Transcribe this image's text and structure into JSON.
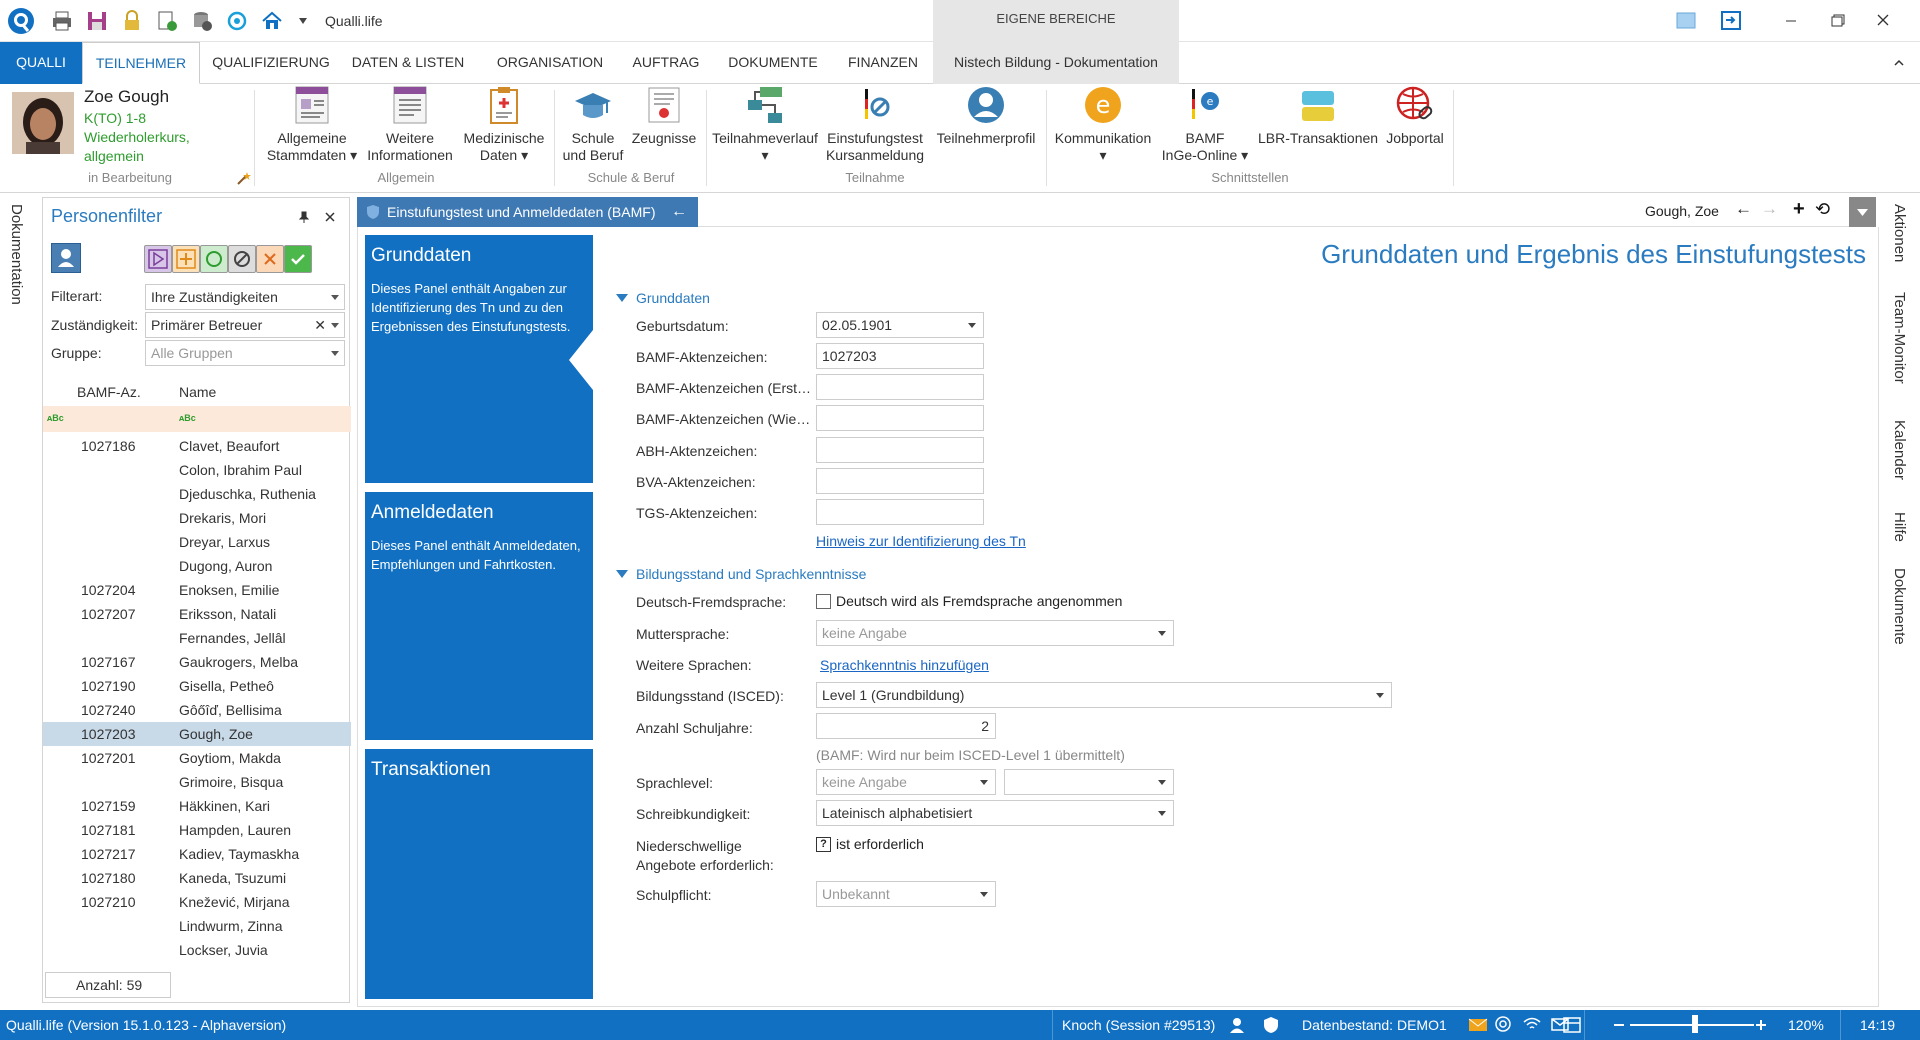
{
  "app": {
    "title": "Qualli.life",
    "context_header": "EIGENE BEREICHE"
  },
  "tabs": {
    "home": "QUALLI",
    "teilnehmer": "TEILNEHMER",
    "qualifizierung": "QUALIFIZIERUNG",
    "daten": "DATEN & LISTEN",
    "organisation": "ORGANISATION",
    "auftrag": "AUFTRAG",
    "dokumente": "DOKUMENTE",
    "finanzen": "FINANZEN",
    "context": "Nistech Bildung - Dokumentation"
  },
  "person": {
    "name": "Zoe Gough",
    "line1": "K(TO) 1-8",
    "line2": "Wiederholerkurs,",
    "line3": "allgemein",
    "status": "in Bearbeitung"
  },
  "ribbon": {
    "allgemeine_stammdaten": [
      "Allgemeine",
      "Stammdaten"
    ],
    "weitere_informationen": [
      "Weitere",
      "Informationen"
    ],
    "medizinische_daten": [
      "Medizinische",
      "Daten"
    ],
    "schule_beruf": [
      "Schule",
      "und Beruf"
    ],
    "zeugnisse": "Zeugnisse",
    "teilnahmeverlauf": "Teilnahmeverlauf",
    "einstufungstest": [
      "Einstufungstest",
      "Kursanmeldung"
    ],
    "teilnehmerprofil": "Teilnehmerprofil",
    "kommunikation": "Kommunikation",
    "bamf": [
      "BAMF",
      "InGe-Online"
    ],
    "lbr": "LBR-Transaktionen",
    "jobportal": "Jobportal",
    "groups": {
      "allgemein": "Allgemein",
      "schule": "Schule & Beruf",
      "teilnahme": "Teilnahme",
      "schnittstellen": "Schnittstellen"
    }
  },
  "side_left": "Dokumentation",
  "side_right": [
    "Aktionen",
    "Team-Monitor",
    "Kalender",
    "Hilfe",
    "Dokumente"
  ],
  "filter": {
    "title": "Personenfilter",
    "filterart_label": "Filterart:",
    "filterart_value": "Ihre Zuständigkeiten",
    "zustaendigkeit_label": "Zuständigkeit:",
    "zustaendigkeit_value": "Primärer Betreuer",
    "gruppe_label": "Gruppe:",
    "gruppe_placeholder": "Alle Gruppen",
    "col_az": "BAMF-Az.",
    "col_name": "Name",
    "rows": [
      {
        "az": "1027186",
        "name": "Clavet, Beaufort"
      },
      {
        "az": "",
        "name": "Colon, Ibrahim Paul"
      },
      {
        "az": "",
        "name": "Djeduschka, Ruthenia"
      },
      {
        "az": "",
        "name": "Drekaris, Mori"
      },
      {
        "az": "",
        "name": "Dreyar, Larxus"
      },
      {
        "az": "",
        "name": "Dugong, Auron"
      },
      {
        "az": "1027204",
        "name": "Enoksen, Emilie"
      },
      {
        "az": "1027207",
        "name": "Eriksson, Natali"
      },
      {
        "az": "",
        "name": "Fernandes, Jellâl"
      },
      {
        "az": "1027167",
        "name": "Gaukrogers, Melba"
      },
      {
        "az": "1027190",
        "name": "Gisella, Petheô"
      },
      {
        "az": "1027240",
        "name": "Gôőîď, Bellisima"
      },
      {
        "az": "1027203",
        "name": "Gough, Zoe"
      },
      {
        "az": "1027201",
        "name": "Goytiom, Makda"
      },
      {
        "az": "",
        "name": "Grimoire, Bisqua"
      },
      {
        "az": "1027159",
        "name": "Häkkinen, Kari"
      },
      {
        "az": "1027181",
        "name": "Hampden, Lauren"
      },
      {
        "az": "1027217",
        "name": "Kadiev, Taymaskha"
      },
      {
        "az": "1027180",
        "name": "Kaneda, Tsuzumi"
      },
      {
        "az": "1027210",
        "name": "Knežević, Mirjana"
      },
      {
        "az": "",
        "name": "Lindwurm, Zinna"
      },
      {
        "az": "",
        "name": "Lockser, Juvia"
      }
    ],
    "count": "Anzahl: 59"
  },
  "doc": {
    "tab": "Einstufungstest und Anmeldedaten (BAMF)",
    "current_person": "Gough, Zoe",
    "heading": "Grunddaten und Ergebnis des Einstufungstests"
  },
  "panels": [
    {
      "title": "Grunddaten",
      "desc": "Dieses Panel enthält Angaben zur Identifizierung des Tn und zu den Ergebnissen des Einstufungstests."
    },
    {
      "title": "Anmeldedaten",
      "desc": "Dieses Panel enthält Anmeldedaten, Empfehlungen und Fahrtkosten."
    },
    {
      "title": "Transaktionen",
      "desc": ""
    }
  ],
  "form": {
    "sec_grunddaten": "Grunddaten",
    "geburtsdatum_label": "Geburtsdatum:",
    "geburtsdatum": "02.05.1901",
    "bamf_az_label": "BAMF-Aktenzeichen:",
    "bamf_az": "1027203",
    "bamf_erst_label": "BAMF-Aktenzeichen (Erst…",
    "bamf_wie_label": "BAMF-Aktenzeichen (Wie…",
    "abh_label": "ABH-Aktenzeichen:",
    "bva_label": "BVA-Aktenzeichen:",
    "tgs_label": "TGS-Aktenzeichen:",
    "hinweis_link": "Hinweis zur Identifizierung des Tn",
    "sec_bildung": "Bildungsstand und Sprachkenntnisse",
    "deutsch_label": "Deutsch-Fremdsprache:",
    "deutsch_cb": "Deutsch wird als Fremdsprache angenommen",
    "mutter_label": "Muttersprache:",
    "mutter": "keine Angabe",
    "weitere_label": "Weitere Sprachen:",
    "weitere_link": "Sprachkenntnis hinzufügen",
    "bildungsstand_label": "Bildungsstand (ISCED):",
    "bildungsstand": "Level 1 (Grundbildung)",
    "schuljahre_label": "Anzahl Schuljahre:",
    "schuljahre": "2",
    "schuljahre_hint": "(BAMF: Wird nur beim ISCED-Level 1 übermittelt)",
    "sprachlevel_label": "Sprachlevel:",
    "sprachlevel": "keine Angabe",
    "schreib_label": "Schreibkundigkeit:",
    "schreib": "Lateinisch alphabetisiert",
    "nieder_label1": "Niederschwellige",
    "nieder_label2": "Angebote erforderlich:",
    "nieder_cb": "ist erforderlich",
    "schulpflicht_label": "Schulpflicht:",
    "schulpflicht": "Unbekannt"
  },
  "status": {
    "version": "Qualli.life (Version 15.1.0.123 - Alphaversion)",
    "session": "Knoch (Session #29513)",
    "datenbestand": "Datenbestand: DEMO1",
    "zoom": "120%",
    "time": "14:19"
  },
  "colors": {
    "accent": "#1170c2",
    "selected_row": "#c8d9e8",
    "heading": "#2a7bc0"
  }
}
